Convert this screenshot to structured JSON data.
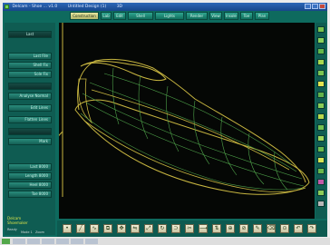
{
  "window": {
    "title_left": "Delcam - Shoe ... v1.0",
    "title_center": "Untitled Design (1)",
    "title_right": "3D"
  },
  "menu_tabs": [
    "Construction",
    "Lab",
    "Edit",
    "Shell",
    "Lights",
    "Render",
    "View",
    "Insole",
    "Toe",
    "Plan"
  ],
  "left_panel": {
    "header": "Last",
    "buttons": [
      "Last File",
      "Shell Fix",
      "Sole Fix",
      "Analyse Normal",
      "Edit Lines",
      "Flatten Lines",
      "Mark"
    ],
    "numeric_fields": [
      "Last 8000",
      "Length 8000",
      "Heel 8000",
      "Toe 8000"
    ],
    "brand_lines": [
      "Delcam",
      "Shoemaker"
    ],
    "status": [
      "Ready",
      "Mode 1",
      "Zoom"
    ]
  },
  "viewport": {
    "name": "3D wireframe view"
  },
  "right_toolbar": {
    "colors": [
      "#79c24c",
      "#8bd15a",
      "#63b84a",
      "#a8d84f",
      "#7ac451",
      "#e2e34f",
      "#61b24a",
      "#88cc55",
      "#b9d84b",
      "#73c14e",
      "#9fd65a",
      "#6bba4b",
      "#d6e352",
      "#68b84a",
      "#c25aa8",
      "#8ccc58",
      "#b8b8b8"
    ]
  },
  "bottom_toolbar": {
    "icons": [
      "point-icon",
      "line-icon",
      "curve-icon",
      "copy-icon",
      "move-icon",
      "mirror-icon",
      "scale-icon",
      "rotate-icon",
      "offset-icon",
      "trim-icon",
      "extend-icon",
      "flip-icon",
      "join-icon",
      "split-icon",
      "pencil-icon",
      "eraser-icon",
      "zoom-icon",
      "undo-icon",
      "redo-icon"
    ]
  },
  "colors": {
    "accent": "#1a7a6a",
    "wire": "#c8b640",
    "wire_green": "#4fa34a"
  }
}
